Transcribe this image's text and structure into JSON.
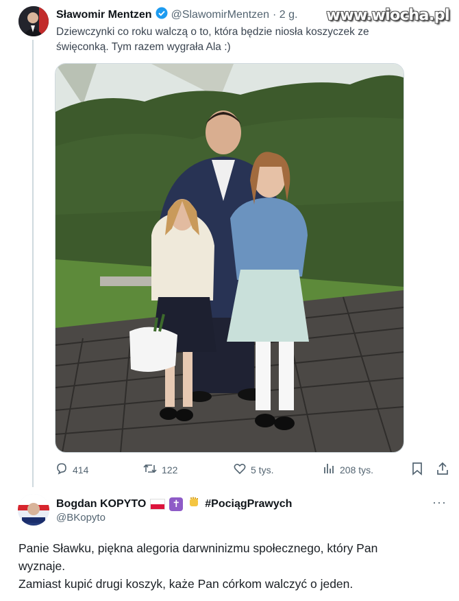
{
  "tweet": {
    "author_name": "Sławomir Mentzen",
    "handle": "@SlawomirMentzen",
    "time": "· 2 g.",
    "text_line1": "Dziewczynki co roku walczą o to, która będzie niosła koszyczek ze",
    "text_line2": "święconką. Tym razem wygrała Ala :)",
    "verified_color": "#1d9bf0",
    "photo_description_colors": {
      "hedge": "#3f5a2e",
      "deck": "#4a4744"
    },
    "actions": {
      "replies": "414",
      "retweets": "122",
      "likes": "5 tys.",
      "views": "208 tys."
    }
  },
  "watermark": "www.wiocha.pl",
  "reply": {
    "author_name": "Bogdan KOPYTO",
    "hashtag": "#PociągPrawych",
    "handle": "@BKopyto",
    "more": "···",
    "body_line1": "Panie Sławku, piękna alegoria darwninizmu społecznego, który Pan",
    "body_line2": "wyznaje.",
    "body_line3": "Zamiast kupić drugi koszyk, każe Pan córkom walczyć o jeden."
  }
}
